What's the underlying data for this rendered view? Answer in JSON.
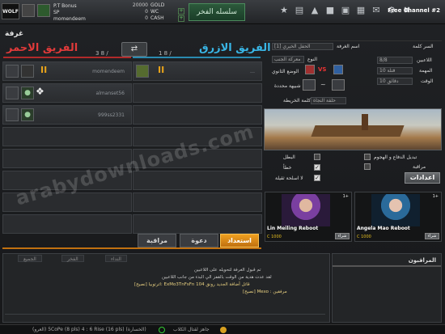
{
  "topbar": {
    "logo_text": "WOLF",
    "player_name": "P.T Bonus",
    "player_sub": "momendeem",
    "sp_label": "SP",
    "gold_label": "GOLD",
    "gold_value": "20000",
    "wc_label": "WC",
    "wc_value": "0",
    "cash_label": "CASH",
    "cash_value": "0",
    "chain_button": "سلسله الفخر",
    "channel": "Free Channel #2"
  },
  "room": {
    "title": "غرفة",
    "red_team": "الفريق الاحمر",
    "blue_team": "الفريق الازرق",
    "red_count": "3 8 /",
    "blue_count": "1 8 /",
    "swap_symbol": "⇄"
  },
  "red_slots": [
    {
      "name": "momendeem",
      "ready": "II",
      "state": "filled"
    },
    {
      "name": "almanset56",
      "ready": "",
      "state": "filled"
    },
    {
      "name": "999ss2331",
      "ready": "",
      "state": "filled"
    },
    {
      "name": "",
      "ready": "",
      "state": "empty"
    },
    {
      "name": "",
      "ready": "",
      "state": "empty"
    },
    {
      "name": "",
      "ready": "",
      "state": "empty"
    },
    {
      "name": "",
      "ready": "",
      "state": "empty"
    },
    {
      "name": "",
      "ready": "",
      "state": "empty"
    }
  ],
  "blue_slots": [
    {
      "name": "…",
      "ready": "II",
      "state": "filled"
    },
    {
      "name": "",
      "ready": "",
      "state": "empty"
    },
    {
      "name": "",
      "ready": "",
      "state": "empty"
    },
    {
      "name": "",
      "ready": "",
      "state": "empty"
    },
    {
      "name": "",
      "ready": "",
      "state": "empty"
    },
    {
      "name": "",
      "ready": "",
      "state": "empty"
    },
    {
      "name": "",
      "ready": "",
      "state": "empty"
    },
    {
      "name": "",
      "ready": "",
      "state": "empty"
    }
  ],
  "settings": {
    "room_name_label": "اسم الغرفة",
    "room_name_value": "[1] الحفل الخيري",
    "password_label": "السر كلمة",
    "mode_label": "النوع",
    "mode_value": "معركة الجنب",
    "secondary_label": "الوضع الثانوي",
    "vs_text": "VS",
    "limit_label": "شبيهة محددة",
    "map_label": "كلمة الخريطة",
    "map_value": "حلقة النجاة",
    "players_label": "اللاعبين",
    "players_value": "8/8",
    "mission_label": "المهمة",
    "mission_value": "10 قتلة",
    "time_label": "الوقت",
    "time_value": "10 دقائق"
  },
  "options": {
    "attack_defense": "تبديل الدفاع و الهجوم",
    "spectate": "مراقبة",
    "hero": "البطل",
    "mistakes": "خطأ",
    "no_heavy": "لا اسلحة ثقيلة",
    "settings_button": "اعدادات"
  },
  "characters": [
    {
      "name": "Lin Meiling Reboot",
      "price": "C 1000",
      "buy": "شراء",
      "level": "1+"
    },
    {
      "name": "Angela Mao Reboot",
      "price": "C 1000",
      "buy": "شراء",
      "level": "1+"
    }
  ],
  "actions": {
    "start": "استعداد",
    "invite": "دعوة",
    "watch": "مراقبة"
  },
  "chat": {
    "tab_all": "الجميع",
    "tab_team": "الفخر",
    "tab_call": "النداء",
    "lines": [
      "تم قبول الغرفة لتحويله على اللاعبين",
      "لقد عدت هدية من الوقت بالقفز الي البدء من جانب اللاعبين",
      "[نصيح] اترتوبيا: ExMo3TnFsFn قاتل أضافة الجديد رونق 104",
      "[نصيح] Mexo : مرفقين"
    ]
  },
  "observers": {
    "title": "المراقبون"
  },
  "status": {
    "left": "(العرو) 5CoPe (8 pls) 4 : 6 Rise (16 pls) (الخسارة)",
    "right": "جاهز لقتال الكلاب"
  },
  "watermark": "arabydownloads.com"
}
